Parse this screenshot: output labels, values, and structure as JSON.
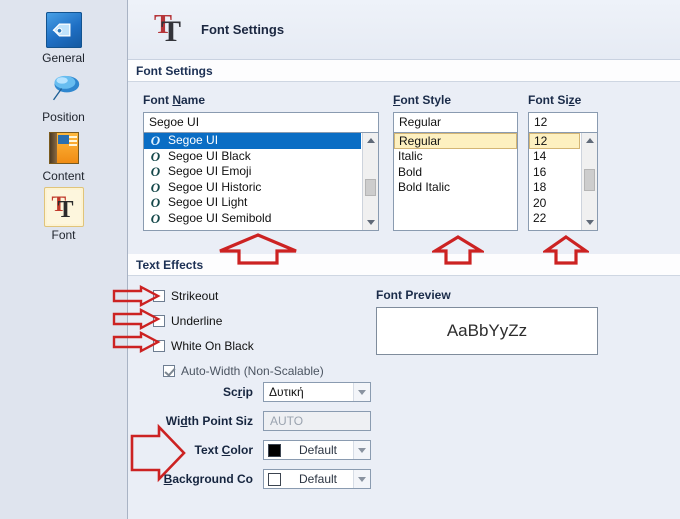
{
  "window": {
    "header_title": "Font Settings",
    "header_icon": "font-tt-icon"
  },
  "sidebar": {
    "items": [
      {
        "label": "General",
        "icon": "tag-icon",
        "selected": false
      },
      {
        "label": "Position",
        "icon": "pin-icon",
        "selected": false
      },
      {
        "label": "Content",
        "icon": "book-icon",
        "selected": false
      },
      {
        "label": "Font",
        "icon": "font-tt-icon",
        "selected": true
      }
    ]
  },
  "sections": {
    "font_settings_title": "Font Settings",
    "text_effects_title": "Text Effects"
  },
  "font_name": {
    "label_pre": "Font ",
    "label_accel": "N",
    "label_post": "ame",
    "input_value": "Segoe UI",
    "items": [
      "Segoe UI",
      "Segoe UI Black",
      "Segoe UI Emoji",
      "Segoe UI Historic",
      "Segoe UI Light",
      "Segoe UI Semibold"
    ],
    "selected_index": 0,
    "item_icon": "opentype-o-icon"
  },
  "font_style": {
    "label_accel": "F",
    "label_post": "ont Style",
    "input_value": "Regular",
    "items": [
      "Regular",
      "Italic",
      "Bold",
      "Bold Italic"
    ],
    "selected_index": 0
  },
  "font_size": {
    "label_pre": "Font Si",
    "label_accel": "z",
    "label_post": "e",
    "input_value": "12",
    "items": [
      "12",
      "14",
      "16",
      "18",
      "20",
      "22"
    ],
    "selected_index": 0
  },
  "text_effects": {
    "checkboxes": [
      {
        "label": "Strikeout",
        "checked": false,
        "disabled": false
      },
      {
        "label": "Underline",
        "checked": false,
        "disabled": false
      },
      {
        "label": "White On Black",
        "checked": false,
        "disabled": false
      },
      {
        "label": "Auto-Width (Non-Scalable)",
        "checked": true,
        "disabled": true
      }
    ],
    "rows": [
      {
        "label_pre": "Sc",
        "label_accel": "r",
        "label_post": "ip",
        "type": "combo",
        "value": "Δυτική",
        "swatch": null
      },
      {
        "label_pre": "Wi",
        "label_accel": "d",
        "label_post": "th Point Siz",
        "type": "readonly",
        "value": "AUTO",
        "swatch": null
      },
      {
        "label_pre": "Text ",
        "label_accel": "C",
        "label_post": "olor",
        "type": "color",
        "value": "Default",
        "swatch": "#000000"
      },
      {
        "label_pre": "",
        "label_accel": "B",
        "label_post": "ackground Co",
        "type": "color",
        "value": "Default",
        "swatch": "#ffffff"
      }
    ]
  },
  "font_preview": {
    "label": "Font Preview",
    "sample_text": "AaBbYyZz"
  },
  "annotations": {
    "arrow_color": "#cc2222",
    "up_arrows": 3,
    "right_arrows": 5
  },
  "colors": {
    "selection_blue": "#0a6dc4",
    "selection_yellow": "#fdf0c0",
    "background": "#eaeef6",
    "sidebar": "#dfe4ee",
    "accent_red": "#b6363a"
  }
}
